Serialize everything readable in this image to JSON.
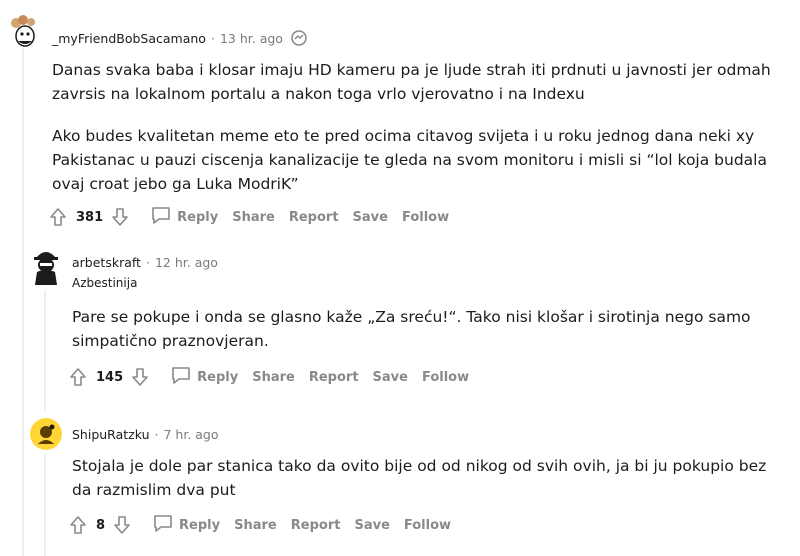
{
  "comments": [
    {
      "username": "_myFriendBobSacamano",
      "time": "13 hr. ago",
      "flair": "",
      "paragraphs": [
        "Danas svaka baba i klosar imaju HD kameru pa je ljude strah iti prdnuti u javnosti jer odmah zavrsis na lokalnom portalu a nakon toga vrlo vjerovatno i na Indexu",
        "Ako budes kvalitetan meme eto te pred ocima citavog svijeta i u roku jednog dana neki xy Pakistanac u pauzi ciscenja kanalizacije te gleda na svom monitoru i misli si “lol koja budala ovaj croat jebo ga Luka ModriK”"
      ],
      "score": "381"
    },
    {
      "username": "arbetskraft",
      "time": "12 hr. ago",
      "flair": "Azbestinija",
      "paragraphs": [
        "Pare se pokupe i onda se glasno kaže „Za sreću!“. Tako nisi klošar i sirotinja nego samo simpatično praznovjeran."
      ],
      "score": "145"
    },
    {
      "username": "ShipuRatzku",
      "time": "7 hr. ago",
      "flair": "",
      "paragraphs": [
        "Stojala je dole par stanica tako da ovito bije od od nikog od svih ovih, ja bi ju pokupio bez da razmislim dva put"
      ],
      "score": "8"
    }
  ],
  "actions": {
    "dot": "·",
    "reply": "Reply",
    "share": "Share",
    "report": "Report",
    "save": "Save",
    "follow": "Follow"
  },
  "colors": {
    "meta_gray": "#787c7e",
    "action_gray": "#878a8c",
    "thread_line": "#edeff1",
    "text": "#1c1c1c"
  },
  "icons": [
    "upvote-icon",
    "downvote-icon",
    "comment-bubble-icon",
    "award-icon"
  ]
}
